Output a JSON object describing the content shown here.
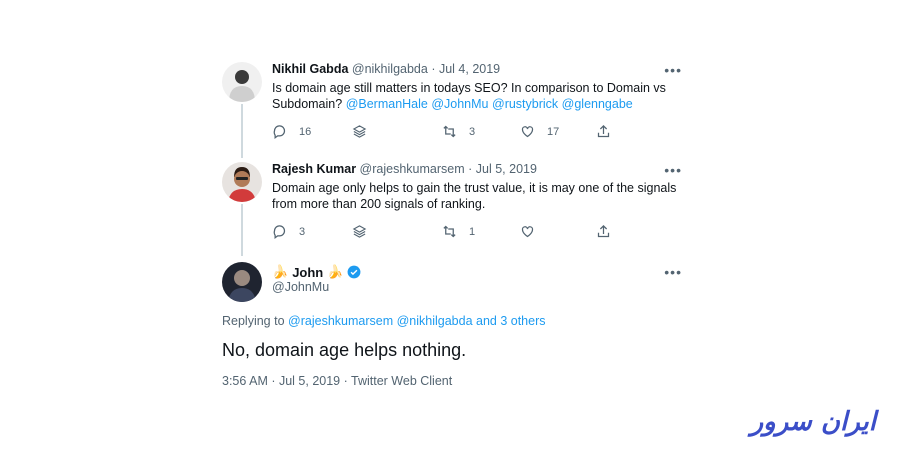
{
  "tweet1": {
    "name": "Nikhil Gabda",
    "handle": "@nikhilgabda",
    "date": "Jul 4, 2019",
    "text_prefix": "Is domain age still matters in todays SEO? In comparison to Domain vs Subdomain?",
    "mentions": [
      "@BermanHale",
      "@JohnMu",
      "@rustybrick",
      "@glenngabe"
    ],
    "replies": "16",
    "retweets": "3",
    "likes": "17"
  },
  "tweet2": {
    "name": "Rajesh Kumar",
    "handle": "@rajeshkumarsem",
    "date": "Jul 5, 2019",
    "text": "Domain age only helps to gain the trust value, it is may one of the signals from more than 200 signals of ranking.",
    "replies": "3",
    "retweets": "1",
    "likes": ""
  },
  "main_tweet": {
    "name": "John",
    "name_emoji": "🍌",
    "handle": "@JohnMu",
    "replying_label": "Replying to",
    "replying_to": "@rajeshkumarsem @nikhilgabda and 3 others",
    "text": "No, domain age helps nothing.",
    "timestamp": "3:56 AM · Jul 5, 2019 · Twitter Web Client"
  },
  "more_icon": "more-horizontal-icon",
  "watermark": {
    "text": "ایران سرور",
    "color": "#3b4ec8"
  },
  "colors": {
    "link": "#1d9bf0",
    "muted": "#536471",
    "thread_line": "#cfd9de",
    "verified": "#1d9bf0"
  }
}
